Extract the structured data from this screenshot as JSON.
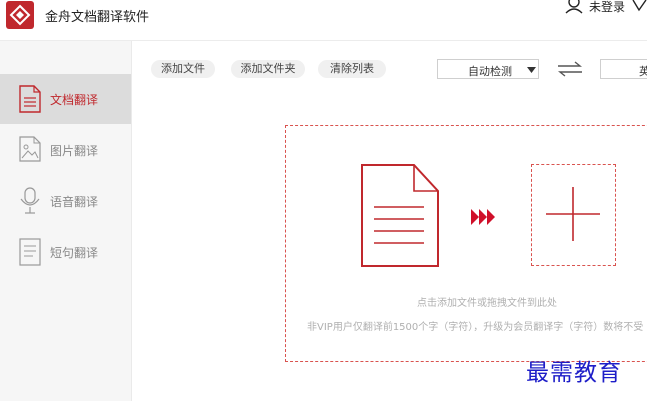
{
  "app": {
    "title": "金舟文档翻译软件"
  },
  "header": {
    "login_label": "未登录"
  },
  "sidebar": {
    "items": [
      {
        "label": "文档翻译",
        "icon": "document-icon",
        "active": true
      },
      {
        "label": "图片翻译",
        "icon": "image-icon",
        "active": false
      },
      {
        "label": "语音翻译",
        "icon": "microphone-icon",
        "active": false
      },
      {
        "label": "短句翻译",
        "icon": "text-lines-icon",
        "active": false
      }
    ]
  },
  "toolbar": {
    "add_file": "添加文件",
    "add_folder": "添加文件夹",
    "clear_list": "清除列表",
    "source_lang": "自动检测",
    "target_lang": "英"
  },
  "dropzone": {
    "hint": "点击添加文件或拖拽文件到此处",
    "note": "非VIP用户仅翻译前1500个字（字符），升级为会员翻译字（字符）数将不受"
  },
  "watermark": "最需教育",
  "colors": {
    "accent": "#c0282d",
    "dashed": "#d9534f",
    "watermark": "#1e1ec8"
  }
}
